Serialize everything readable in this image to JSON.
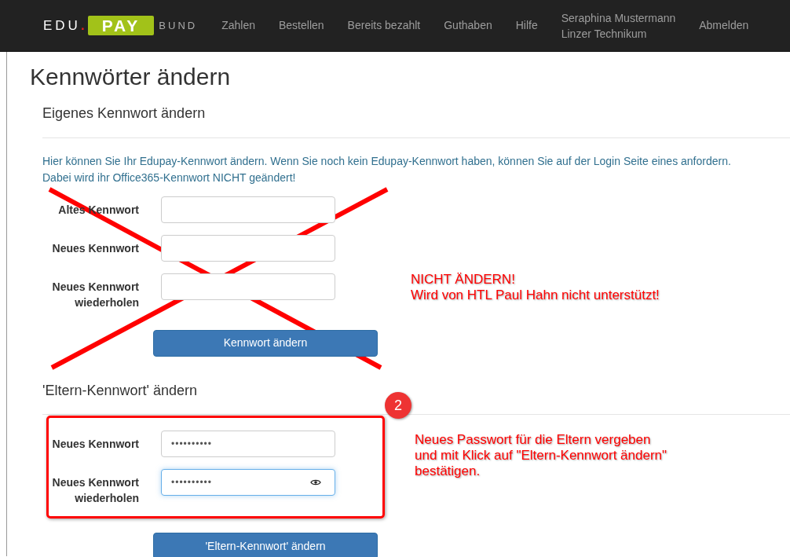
{
  "navbar": {
    "logo": {
      "edu": "EDU",
      "dot": ".",
      "pay": "PAY",
      "bund": "BUND"
    },
    "links": [
      {
        "label": "Zahlen"
      },
      {
        "label": "Bestellen"
      },
      {
        "label": "Bereits bezahlt"
      },
      {
        "label": "Guthaben"
      },
      {
        "label": "Hilfe"
      }
    ],
    "user": {
      "name": "Seraphina Mustermann",
      "school": "Linzer Technikum"
    },
    "logout": "Abmelden"
  },
  "title": "Kennwörter ändern",
  "sections": [
    {
      "heading": "Eigenes Kennwort ändern",
      "info": [
        "Hier können Sie Ihr Edupay-Kennwort ändern. Wenn Sie noch kein Edupay-Kennwort haben, können Sie auf der Login Seite eines anfordern.",
        "Dabei wird ihr Office365-Kennwort NICHT geändert!"
      ],
      "fields": [
        {
          "label": "Altes Kennwort",
          "focused": false,
          "reveal_icon": false
        },
        {
          "label": "Neues Kennwort",
          "focused": false,
          "reveal_icon": false
        },
        {
          "label": "Neues Kennwort wiederholen",
          "focused": false,
          "reveal_icon": false
        }
      ],
      "button": "Kennwort ändern"
    },
    {
      "heading": "'Eltern-Kennwort' ändern",
      "fields": [
        {
          "label": "Neues Kennwort",
          "value": "••••••••••",
          "focused": false,
          "reveal_icon": false
        },
        {
          "label": "Neues Kennwort wiederholen",
          "value": "••••••••••",
          "focused": true,
          "reveal_icon": true
        }
      ],
      "button": "'Eltern-Kennwort' ändern"
    }
  ],
  "annotations": [
    {
      "kind": "cross"
    },
    {
      "kind": "note",
      "lines": [
        "NICHT ÄNDERN!",
        "Wird von HTL Paul Hahn nicht unterstützt!"
      ]
    },
    {
      "kind": "frame"
    },
    {
      "kind": "step",
      "number": "2"
    },
    {
      "kind": "note",
      "lines": [
        "Neues Passwort für die Eltern vergeben",
        "und mit Klick auf \"Eltern-Kennwort ändern\"",
        "bestätigen."
      ]
    }
  ]
}
